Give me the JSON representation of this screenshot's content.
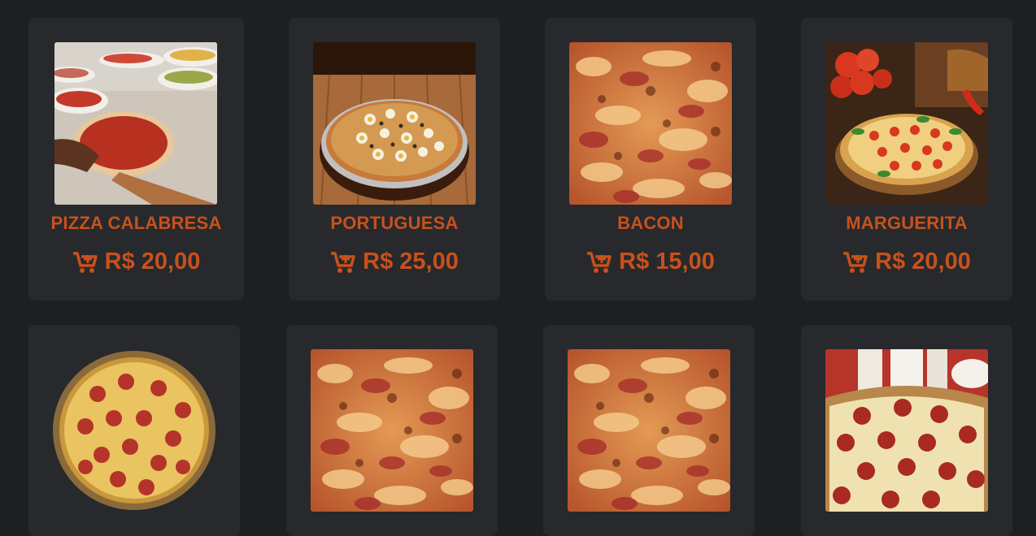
{
  "products": [
    {
      "name": "PIZZA CALABRESA",
      "price": "R$ 20,00",
      "cart_icon": "cart-add-icon",
      "image": "calabresa-prep-photo"
    },
    {
      "name": "PORTUGUESA",
      "price": "R$ 25,00",
      "cart_icon": "cart-add-icon",
      "image": "portuguesa-photo"
    },
    {
      "name": "BACON",
      "price": "R$ 15,00",
      "cart_icon": "cart-add-icon",
      "image": "bacon-closeup-photo"
    },
    {
      "name": "MARGUERITA",
      "price": "R$ 20,00",
      "cart_icon": "cart-add-icon",
      "image": "marguerita-photo"
    },
    {
      "image": "pepperoni-basket-photo"
    },
    {
      "image": "bacon-closeup-photo"
    },
    {
      "image": "bacon-closeup-photo"
    },
    {
      "image": "pepperoni-closeup-photo"
    }
  ],
  "colors": {
    "background": "#1d1f22",
    "card": "#27292c",
    "accent": "#c8511c"
  }
}
